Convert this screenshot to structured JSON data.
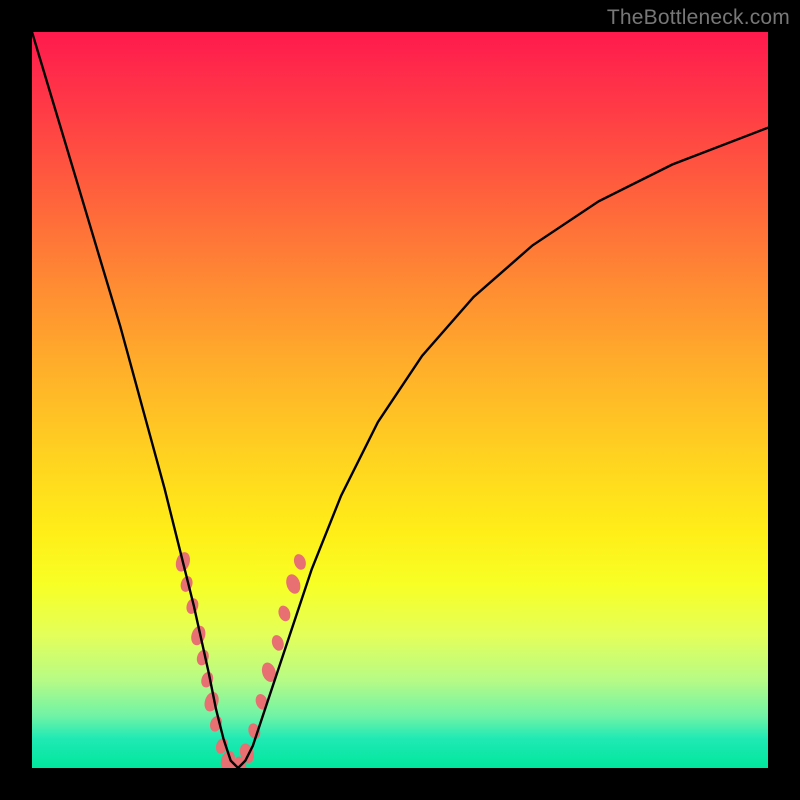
{
  "watermark": "TheBottleneck.com",
  "colors": {
    "frame": "#000000",
    "curve": "#000000",
    "marker": "#e86f72",
    "gradient_top": "#ff1a4d",
    "gradient_bottom": "#00e79c"
  },
  "chart_data": {
    "type": "line",
    "title": "",
    "xlabel": "",
    "ylabel": "",
    "xlim": [
      0,
      100
    ],
    "ylim": [
      0,
      100
    ],
    "note": "Axes unlabeled; values are estimated from pixel positions. y represents vertical height of the curve (0 at bottom, 100 at top).",
    "series": [
      {
        "name": "bottleneck-curve",
        "x": [
          0,
          3,
          6,
          9,
          12,
          15,
          18,
          20,
          22,
          24,
          25,
          26,
          27,
          28,
          29,
          30,
          32,
          35,
          38,
          42,
          47,
          53,
          60,
          68,
          77,
          87,
          100
        ],
        "y": [
          100,
          90,
          80,
          70,
          60,
          49,
          38,
          30,
          22,
          13,
          8,
          4,
          1,
          0,
          1,
          3,
          9,
          18,
          27,
          37,
          47,
          56,
          64,
          71,
          77,
          82,
          87
        ]
      }
    ],
    "markers": {
      "name": "highlight-points",
      "note": "Salmon bead-like marker positions along the lower part of the V, estimated.",
      "points": [
        {
          "x": 20.5,
          "y": 28
        },
        {
          "x": 21.0,
          "y": 25
        },
        {
          "x": 21.8,
          "y": 22
        },
        {
          "x": 22.6,
          "y": 18
        },
        {
          "x": 23.2,
          "y": 15
        },
        {
          "x": 23.8,
          "y": 12
        },
        {
          "x": 24.4,
          "y": 9
        },
        {
          "x": 25.0,
          "y": 6
        },
        {
          "x": 25.8,
          "y": 3
        },
        {
          "x": 26.6,
          "y": 1
        },
        {
          "x": 27.4,
          "y": 0
        },
        {
          "x": 28.3,
          "y": 0.5
        },
        {
          "x": 29.2,
          "y": 2
        },
        {
          "x": 30.2,
          "y": 5
        },
        {
          "x": 31.2,
          "y": 9
        },
        {
          "x": 32.2,
          "y": 13
        },
        {
          "x": 33.4,
          "y": 17
        },
        {
          "x": 34.3,
          "y": 21
        },
        {
          "x": 35.5,
          "y": 25
        },
        {
          "x": 36.4,
          "y": 28
        }
      ]
    }
  }
}
